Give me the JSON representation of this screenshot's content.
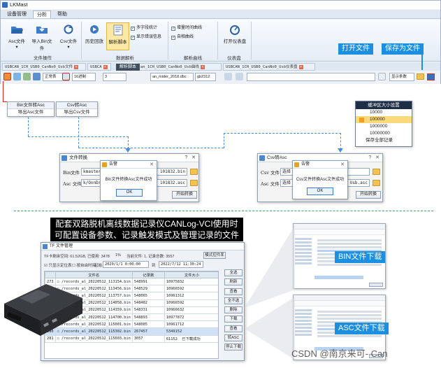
{
  "app": {
    "title": "LKMast"
  },
  "menu": [
    "设备管理",
    "分析",
    "帮助"
  ],
  "ribbon": {
    "buttons": [
      "Asc文件",
      "导入Bin文件",
      "Csv文件",
      "历史回放",
      "解析脚本"
    ],
    "checkboxes_a": [
      "多字段统计",
      "显示错误信息"
    ],
    "checkboxes_b": [
      "增量时间曲线",
      "自相曲线"
    ],
    "button_dashboard": "打开仪表盘",
    "groups": [
      "文件操作",
      "数据解析",
      "解析曲线",
      "仪表盘"
    ],
    "tooltip": "解析脚本"
  },
  "doc_tabs": [
    "USBCAN_1CH_USB0_CanNo0_Usb文件",
    "USBCA",
    "an_1CH_USB0_CanNo0_Usb曲线",
    "USBCAN_1CH_USB0_CanNo0_Usb仪表盘"
  ],
  "toolbar": {
    "mode": "正常表",
    "count": "16进制",
    "rate": "3",
    "file": "an_mider_2018.dbc",
    "encoding": "gb2312",
    "display_count": "显示条数"
  },
  "callouts": {
    "open_file": "打开文件",
    "save_as": "保存为文件",
    "bin_download": "BIN文件下载",
    "asc_download": "ASC文件下载"
  },
  "popup_bin": {
    "line1": "Bin文件转Asc",
    "line2": "导出Asc文件"
  },
  "popup_csv": {
    "line1": "Csv转Asc",
    "line2": "导出Csv文件"
  },
  "dropdown": {
    "header": "缓冲区大小设置",
    "items": [
      "10000",
      "100000",
      "1000000",
      "10000000"
    ],
    "footer": "保存全部记录"
  },
  "dlg_bin": {
    "title": "文件转换",
    "label_bin": "Bin文件",
    "label_asc": "Asc 文件",
    "bin_value": "kmaster",
    "bin_tail": "101832.bin",
    "asc_value": "k/OnnDr",
    "asc_tail": "101832.asc",
    "start": "开始转换",
    "alert_title": "告警",
    "alert_msg": "Bin文件转换Asc文件成功",
    "ok": "OK"
  },
  "dlg_csv": {
    "title": "Csv转Asc",
    "label_csv": "Csv 文件",
    "label_asc": "Asc 文件",
    "csv_value": "选择",
    "csv_tail": "",
    "asc_value": "选择",
    "asc_tail": "Usb.asc",
    "start": "开始转换",
    "alert_title": "告警",
    "alert_msg": "Csv文件转换Asc文件成功",
    "ok": "OK"
  },
  "banner": "配套双路脱机离线数据记录仪CANLog-VCI使用时可配置设备参数、记录触发模式及管理记录的文件",
  "tf": {
    "title": "TF 文件管理",
    "info_left": "TF卡剩余空间: 61.52GB, 已使用: 3478",
    "info_pct": "1%",
    "info_mid": "当前文件: 1, 记录总数: 3557",
    "mode_btn": "模式控件率",
    "filter1": "只显示定位表",
    "filter2": "按自由时间",
    "filter_label": "起始",
    "date_from": "2020/1/1 0:00:00",
    "date_to_label": "到",
    "date_to": "2022/7/12 11:30:24",
    "columns": [
      "文件名",
      "记录数",
      "文件大小"
    ],
    "rows": [
      [
        "273",
        "/records_al_20220512_113154.bin",
        "548991",
        "10975832"
      ],
      [
        "274",
        "/records_al_20220512_113456.bin",
        "548529",
        "10966592"
      ],
      [
        "275",
        "/records_al_20220512_113757.bin",
        "548065",
        "10961312"
      ],
      [
        "276",
        "/records_al_20220512_114058.bin",
        "548482",
        "10966592"
      ],
      [
        "277",
        "/records_al_20220512_114359.bin",
        "548331",
        "10966632"
      ],
      [
        "278",
        "/records_al_20220512_114700.bin",
        "548893",
        "10977872"
      ],
      [
        "279",
        "/records_al_20220512_115001.bin",
        "548085",
        "10961712"
      ],
      [
        "280",
        "/records_al_20220512_115302.bin",
        "267457",
        "5349152"
      ],
      [
        "281",
        "/records_al_20220512_115603.bin",
        "3057",
        "61152"
      ]
    ],
    "last_status": "已下载成功",
    "side_buttons": [
      "全选",
      "刷新",
      "查看",
      "全不选",
      "删除",
      "下载",
      "查看",
      "转ASC",
      "停止下载"
    ]
  },
  "watermark": "CSDN @南京来可- Can"
}
